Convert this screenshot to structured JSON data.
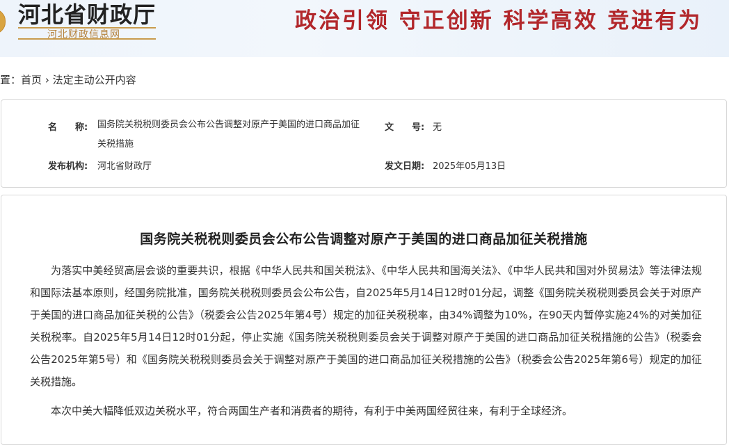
{
  "header": {
    "site_name": "河北省财政厅",
    "site_subtitle": "河北财政信息网",
    "slogan": "政治引领  守正创新  科学高效  竞进有为"
  },
  "breadcrumb": {
    "prefix": "位置：",
    "home": "首页",
    "separator": "›",
    "current": "法定主动公开内容"
  },
  "info": {
    "name_label": "名　　称:",
    "name_value": "国务院关税税则委员会公布公告调整对原产于美国的进口商品加征关税措施",
    "doc_no_label": "文　　号:",
    "doc_no_value": "无",
    "publisher_label": "发布机构:",
    "publisher_value": "河北省财政厅",
    "date_label": "发文日期:",
    "date_value": "2025年05月13日"
  },
  "article": {
    "title": "国务院关税税则委员会公布公告调整对原产于美国的进口商品加征关税措施",
    "paragraphs": [
      "为落实中美经贸高层会谈的重要共识，根据《中华人民共和国关税法》、《中华人民共和国海关法》、《中华人民共和国对外贸易法》等法律法规和国际法基本原则，经国务院批准，国务院关税税则委员会公布公告，自2025年5月14日12时01分起，调整《国务院关税税则委员会关于对原产于美国的进口商品加征关税的公告》（税委会公告2025年第4号）规定的加征关税税率，由34%调整为10%，在90天内暂停实施24%的对美加征关税税率。自2025年5月14日12时01分起，停止实施《国务院关税税则委员会关于调整对原产于美国的进口商品加征关税措施的公告》（税委会公告2025年第5号）和《国务院关税税则委员会关于调整对原产于美国的进口商品加征关税措施的公告》（税委会公告2025年第6号）规定的加征关税措施。",
      "本次中美大幅降低双边关税水平，符合两国生产者和消费者的期待，有利于中美两国经贸往来，有利于全球经济。"
    ]
  },
  "colors": {
    "slogan_red": "#b2272b",
    "subtitle_gold": "#b4803a",
    "banner_bg": "#eef4fb"
  }
}
